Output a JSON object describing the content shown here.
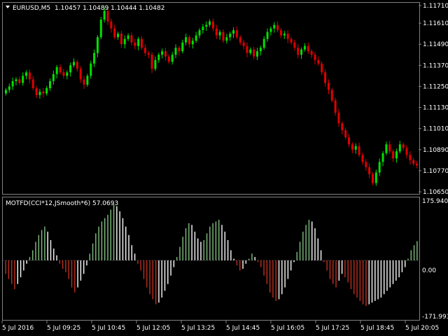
{
  "chart_title": {
    "symbol": "EURUSD,M5",
    "ohlc": "1.10457 1.10489 1.10444 1.10482"
  },
  "indicator": {
    "title": "MOTFD(CCI*12,JSmooth*6) 57.0693",
    "upper_label": "175.9405",
    "zero_label": "0.00",
    "lower_label": "-171.9934"
  },
  "price_axis": [
    "1.11710",
    "1.11610",
    "1.11490",
    "1.11370",
    "1.11250",
    "1.11130",
    "1.11010",
    "1.10890",
    "1.10770",
    "1.10650"
  ],
  "time_axis": [
    "5 Jul 2016",
    "5 Jul 09:25",
    "5 Jul 10:45",
    "5 Jul 12:05",
    "5 Jul 13:25",
    "5 Jul 14:45",
    "5 Jul 16:05",
    "5 Jul 17:25",
    "5 Jul 18:45",
    "5 Jul 20:05"
  ],
  "colors": {
    "background": "#000000",
    "bull": "#00e000",
    "bear": "#e00000",
    "hist_green": "#80c080",
    "hist_red": "#c03020",
    "hist_white": "#ffffff",
    "grid": "#404040"
  },
  "chart_data": [
    {
      "type": "candlestick",
      "ylim": [
        1.1065,
        1.1171
      ],
      "close": [
        1.1123,
        1.1125,
        1.1128,
        1.1129,
        1.1127,
        1.1131,
        1.1133,
        1.1129,
        1.1124,
        1.112,
        1.1122,
        1.1121,
        1.1124,
        1.1128,
        1.1132,
        1.1136,
        1.1133,
        1.1131,
        1.1133,
        1.1137,
        1.1139,
        1.1135,
        1.1129,
        1.1126,
        1.1131,
        1.1138,
        1.1144,
        1.1153,
        1.1163,
        1.1168,
        1.1162,
        1.1158,
        1.1153,
        1.1155,
        1.1149,
        1.1152,
        1.1154,
        1.115,
        1.1148,
        1.1152,
        1.1147,
        1.1144,
        1.1143,
        1.1135,
        1.114,
        1.1143,
        1.1145,
        1.1142,
        1.1139,
        1.1143,
        1.1147,
        1.1145,
        1.115,
        1.1153,
        1.1149,
        1.1151,
        1.1154,
        1.1157,
        1.1159,
        1.116,
        1.1162,
        1.1158,
        1.1154,
        1.1156,
        1.1151,
        1.1153,
        1.1155,
        1.1157,
        1.1153,
        1.115,
        1.1148,
        1.1144,
        1.1146,
        1.1142,
        1.1145,
        1.1147,
        1.1152,
        1.1156,
        1.1158,
        1.116,
        1.1157,
        1.1154,
        1.1155,
        1.1152,
        1.115,
        1.1147,
        1.1143,
        1.1146,
        1.1148,
        1.1145,
        1.1143,
        1.114,
        1.1138,
        1.1133,
        1.1127,
        1.1123,
        1.1117,
        1.111,
        1.1104,
        1.11,
        1.1096,
        1.1092,
        1.1089,
        1.1091,
        1.1086,
        1.1082,
        1.1079,
        1.1075,
        1.107,
        1.1076,
        1.1082,
        1.1087,
        1.1092,
        1.1088,
        1.1084,
        1.1088,
        1.1092,
        1.109,
        1.1086,
        1.1083,
        1.1081,
        1.108
      ]
    },
    {
      "type": "histogram",
      "ylim": [
        -171.9934,
        175.9405
      ],
      "values": [
        -40,
        -55,
        -70,
        -85,
        -70,
        -50,
        -30,
        -10,
        10,
        30,
        55,
        75,
        90,
        100,
        85,
        60,
        35,
        15,
        -10,
        -25,
        -35,
        -55,
        -80,
        -95,
        -80,
        -60,
        -40,
        -15,
        20,
        50,
        80,
        100,
        115,
        125,
        135,
        150,
        165,
        160,
        145,
        125,
        100,
        75,
        45,
        20,
        -10,
        -30,
        -55,
        -80,
        -100,
        -115,
        -130,
        -125,
        -110,
        -90,
        -70,
        -45,
        -20,
        10,
        40,
        70,
        95,
        110,
        105,
        85,
        65,
        55,
        60,
        80,
        100,
        110,
        115,
        120,
        105,
        85,
        60,
        30,
        5,
        -15,
        -30,
        -25,
        -10,
        5,
        20,
        10,
        -5,
        -20,
        -45,
        -70,
        -95,
        -110,
        -120,
        -115,
        -100,
        -80,
        -55,
        -30,
        -5,
        25,
        55,
        85,
        105,
        120,
        115,
        95,
        65,
        30,
        -5,
        -30,
        -55,
        -70,
        -80,
        -60,
        -40,
        -50,
        -65,
        -85,
        -100,
        -110,
        -120,
        -130,
        -135,
        -130,
        -125,
        -120,
        -115,
        -110,
        -100,
        -90,
        -80,
        -70,
        -60,
        -50,
        -35,
        -20,
        5,
        30,
        45,
        57.0693
      ]
    }
  ]
}
